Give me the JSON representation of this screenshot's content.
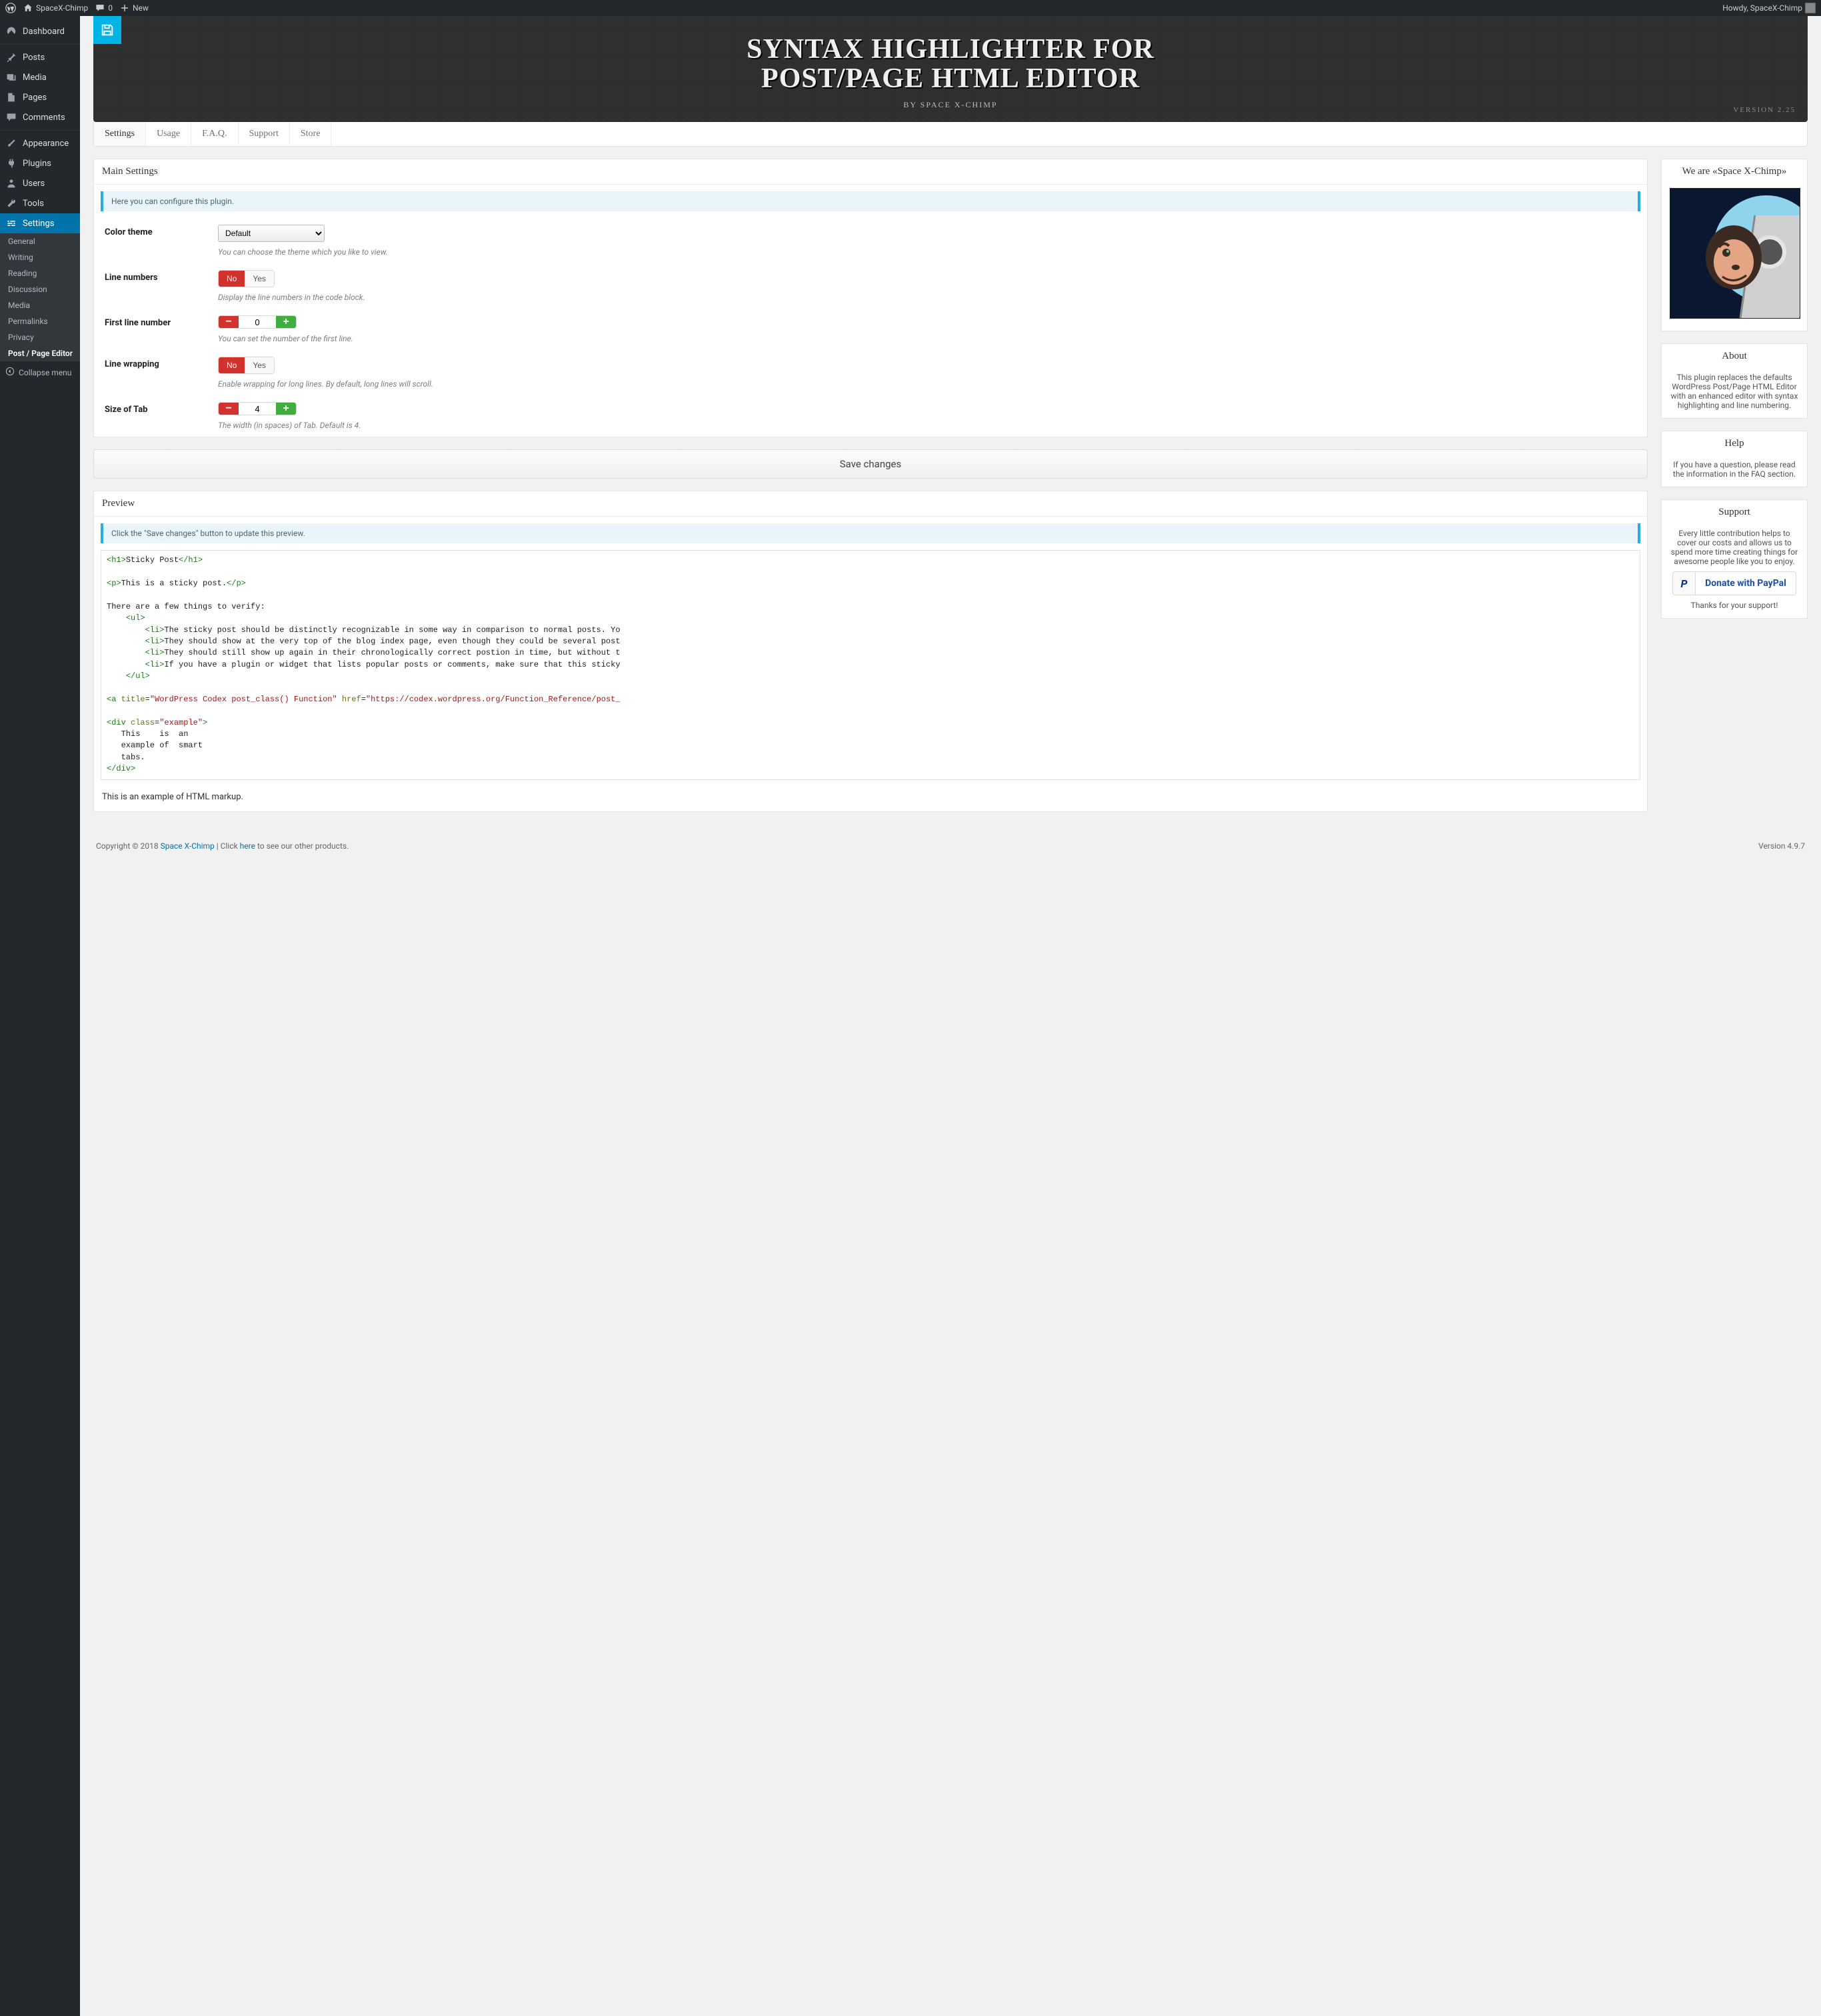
{
  "adminbar": {
    "site": "SpaceX-Chimp",
    "comments": "0",
    "new": "New",
    "howdy": "Howdy, SpaceX-Chimp"
  },
  "sidebar": {
    "items": [
      {
        "label": "Dashboard"
      },
      {
        "label": "Posts"
      },
      {
        "label": "Media"
      },
      {
        "label": "Pages"
      },
      {
        "label": "Comments"
      },
      {
        "label": "Appearance"
      },
      {
        "label": "Plugins"
      },
      {
        "label": "Users"
      },
      {
        "label": "Tools"
      },
      {
        "label": "Settings"
      }
    ],
    "submenu": [
      "General",
      "Writing",
      "Reading",
      "Discussion",
      "Media",
      "Permalinks",
      "Privacy",
      "Post / Page Editor"
    ],
    "collapse": "Collapse menu"
  },
  "banner": {
    "title_l1": "SYNTAX HIGHLIGHTER FOR",
    "title_l2": "POST/PAGE HTML EDITOR",
    "subtitle": "BY SPACE X-CHIMP",
    "version": "VERSION 2.25"
  },
  "tabs": [
    "Settings",
    "Usage",
    "F.A.Q.",
    "Support",
    "Store"
  ],
  "main": {
    "heading": "Main Settings",
    "notice": "Here you can configure this plugin.",
    "color_theme": {
      "label": "Color theme",
      "value": "Default",
      "desc": "You can choose the theme which you like to view."
    },
    "line_numbers": {
      "label": "Line numbers",
      "no": "No",
      "yes": "Yes",
      "desc": "Display the line numbers in the code block."
    },
    "first_line": {
      "label": "First line number",
      "value": "0",
      "desc": "You can set the number of the first line."
    },
    "line_wrap": {
      "label": "Line wrapping",
      "no": "No",
      "yes": "Yes",
      "desc": "Enable wrapping for long lines. By default, long lines will scroll."
    },
    "tab_size": {
      "label": "Size of Tab",
      "value": "4",
      "desc": "The width (in spaces) of Tab. Default is 4."
    },
    "save": "Save changes"
  },
  "preview": {
    "heading": "Preview",
    "notice": "Click the \"Save changes\" button to update this preview.",
    "caption": "This is an example of HTML markup.",
    "lines": {
      "l1a": "<h1>",
      "l1b": "Sticky Post",
      "l1c": "</h1>",
      "l2a": "<p>",
      "l2b": "This is a sticky post.",
      "l2c": "</p>",
      "l3": "There are a few things to verify:",
      "ul_o": "<ul>",
      "ul_c": "</ul>",
      "li_o": "<li>",
      "li1": "The sticky post should be distinctly recognizable in some way in comparison to normal posts. Yo",
      "li2": "They should show at the very top of the blog index page, even though they could be several post",
      "li3": "They should still show up again in their chronologically correct postion in time, but without t",
      "li4": "If you have a plugin or widget that lists popular posts or comments, make sure that this sticky",
      "a1": "<a ",
      "a2": "title",
      "a3": "=",
      "a4": "\"WordPress Codex post_class() Function\"",
      "a5": " href",
      "a6": "=",
      "a7": "\"https://codex.wordpress.org/Function_Reference/post_",
      "d1": "<div ",
      "d2": "class",
      "d3": "=",
      "d4": "\"example\"",
      "d5": ">",
      "body1": "   This    is  an",
      "body2": "   example of  smart",
      "body3": "   tabs.",
      "dclose": "</div>"
    }
  },
  "side": {
    "we_are": "We are «Space X-Chimp»",
    "about_h": "About",
    "about": "This plugin replaces the defaults WordPress Post/Page HTML Editor with an enhanced editor with syntax highlighting and line numbering.",
    "help_h": "Help",
    "help": "If you have a question, please read the information in the FAQ section.",
    "support_h": "Support",
    "support": "Every little contribution helps to cover our costs and allows us to spend more time creating things for awesome people like you to enjoy.",
    "donate": "Donate with PayPal",
    "thanks": "Thanks for your support!"
  },
  "footer": {
    "copy_pre": "Copyright © 2018 ",
    "copy_link": "Space X-Chimp",
    "copy_mid": " | Click ",
    "copy_here": "here",
    "copy_post": " to see our other products.",
    "wpver": "Version 4.9.7"
  }
}
